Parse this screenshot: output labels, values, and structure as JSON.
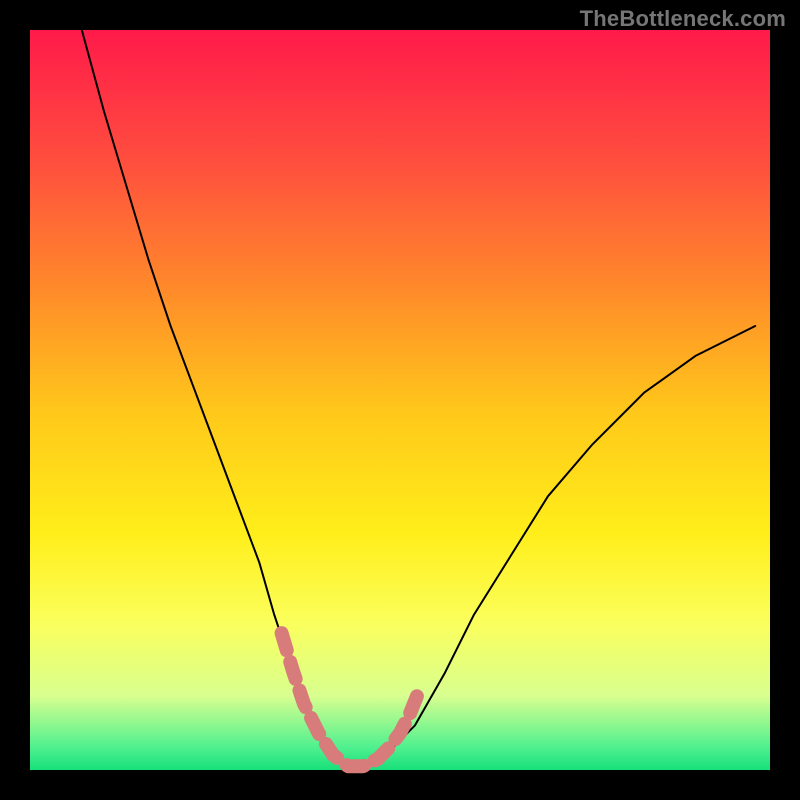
{
  "watermark": "TheBottleneck.com",
  "chart_data": {
    "type": "line",
    "title": "",
    "xlabel": "",
    "ylabel": "",
    "xlim": [
      0,
      100
    ],
    "ylim": [
      0,
      100
    ],
    "gradient_background": {
      "orientation": "vertical",
      "stops": [
        {
          "pos": 0.0,
          "color": "#ff1a4a",
          "meaning": "worst"
        },
        {
          "pos": 0.5,
          "color": "#ffe01a",
          "meaning": "mid"
        },
        {
          "pos": 1.0,
          "color": "#17e07a",
          "meaning": "best"
        }
      ]
    },
    "series": [
      {
        "name": "bottleneck-curve",
        "color": "#000000",
        "x": [
          7,
          10,
          13,
          16,
          19,
          22,
          25,
          28,
          31,
          33,
          35,
          37,
          39,
          41,
          43,
          45,
          48,
          52,
          56,
          60,
          65,
          70,
          76,
          83,
          90,
          98
        ],
        "y": [
          100,
          89,
          79,
          69,
          60,
          52,
          44,
          36,
          28,
          21,
          15,
          10,
          5,
          2,
          0,
          0,
          2,
          6,
          13,
          21,
          29,
          37,
          44,
          51,
          56,
          60
        ]
      },
      {
        "name": "optimal-range-marker",
        "color": "#d87b7b",
        "type": "scatter",
        "x": [
          34.0,
          35.5,
          37.0,
          39.0,
          41.0,
          43.0,
          45.0,
          47.0,
          48.5,
          50.0,
          51.3,
          52.5
        ],
        "y": [
          18.5,
          13.5,
          9.0,
          5.0,
          2.0,
          0.5,
          0.5,
          1.5,
          3.0,
          5.0,
          7.5,
          10.5
        ]
      }
    ],
    "annotations": []
  }
}
